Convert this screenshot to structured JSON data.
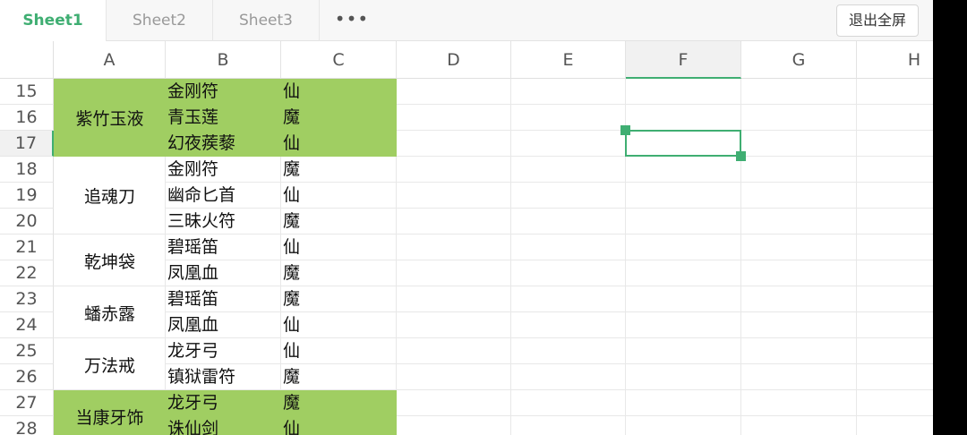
{
  "tabs": [
    {
      "label": "Sheet1",
      "active": true
    },
    {
      "label": "Sheet2",
      "active": false
    },
    {
      "label": "Sheet3",
      "active": false
    }
  ],
  "more_label": "•••",
  "exit_label": "退出全屏",
  "columns": [
    "A",
    "B",
    "C",
    "D",
    "E",
    "F",
    "G",
    "H"
  ],
  "selected_column": "F",
  "selected_row": "17",
  "rows": [
    "15",
    "16",
    "17",
    "18",
    "19",
    "20",
    "21",
    "22",
    "23",
    "24",
    "25",
    "26",
    "27",
    "28"
  ],
  "groups": [
    {
      "name": "紫竹玉液",
      "highlight": true,
      "items": [
        {
          "b": "金刚符",
          "c": "仙"
        },
        {
          "b": "青玉莲",
          "c": "魔"
        },
        {
          "b": "幻夜蒺藜",
          "c": "仙"
        }
      ]
    },
    {
      "name": "追魂刀",
      "highlight": false,
      "items": [
        {
          "b": "金刚符",
          "c": "魔"
        },
        {
          "b": "幽命匕首",
          "c": "仙"
        },
        {
          "b": "三昧火符",
          "c": "魔"
        }
      ]
    },
    {
      "name": "乾坤袋",
      "highlight": false,
      "items": [
        {
          "b": "碧瑶笛",
          "c": "仙"
        },
        {
          "b": "凤凰血",
          "c": "魔"
        }
      ]
    },
    {
      "name": "蟠赤露",
      "highlight": false,
      "items": [
        {
          "b": "碧瑶笛",
          "c": "魔"
        },
        {
          "b": "凤凰血",
          "c": "仙"
        }
      ]
    },
    {
      "name": "万法戒",
      "highlight": false,
      "items": [
        {
          "b": "龙牙弓",
          "c": "仙"
        },
        {
          "b": "镇狱雷符",
          "c": "魔"
        }
      ]
    },
    {
      "name": "当康牙饰",
      "highlight": true,
      "items": [
        {
          "b": "龙牙弓",
          "c": "魔"
        },
        {
          "b": "诛仙剑",
          "c": "仙"
        }
      ]
    }
  ],
  "colors": {
    "accent": "#3fae72",
    "highlight_fill": "#a0ce62"
  }
}
